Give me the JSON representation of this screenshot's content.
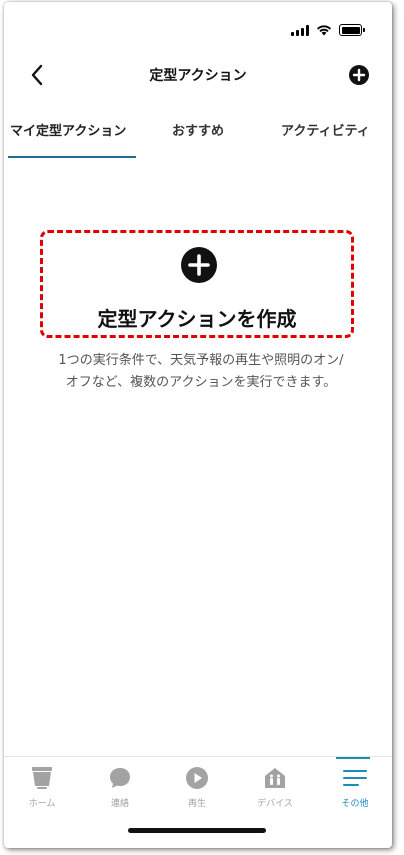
{
  "header": {
    "title": "定型アクション"
  },
  "tabs": [
    {
      "label": "マイ定型アクション",
      "active": true
    },
    {
      "label": "おすすめ",
      "active": false
    },
    {
      "label": "アクティビティ",
      "active": false
    }
  ],
  "create": {
    "label": "定型アクションを作成",
    "description_line1": "1つの実行条件で、天気予報の再生や照明のオン/",
    "description_line2": "オフなど、複数のアクションを実行できます。"
  },
  "bottom_nav": [
    {
      "label": "ホーム",
      "icon": "home-icon",
      "active": false
    },
    {
      "label": "連絡",
      "icon": "chat-bubble-icon",
      "active": false
    },
    {
      "label": "再生",
      "icon": "play-icon",
      "active": false
    },
    {
      "label": "デバイス",
      "icon": "device-icon",
      "active": false
    },
    {
      "label": "その他",
      "icon": "menu-lines-icon",
      "active": true
    }
  ],
  "colors": {
    "accent": "#1d8bb7",
    "tab_underline": "#1d6e93",
    "highlight_border": "#e00000",
    "nav_inactive": "#a3a3a3"
  }
}
